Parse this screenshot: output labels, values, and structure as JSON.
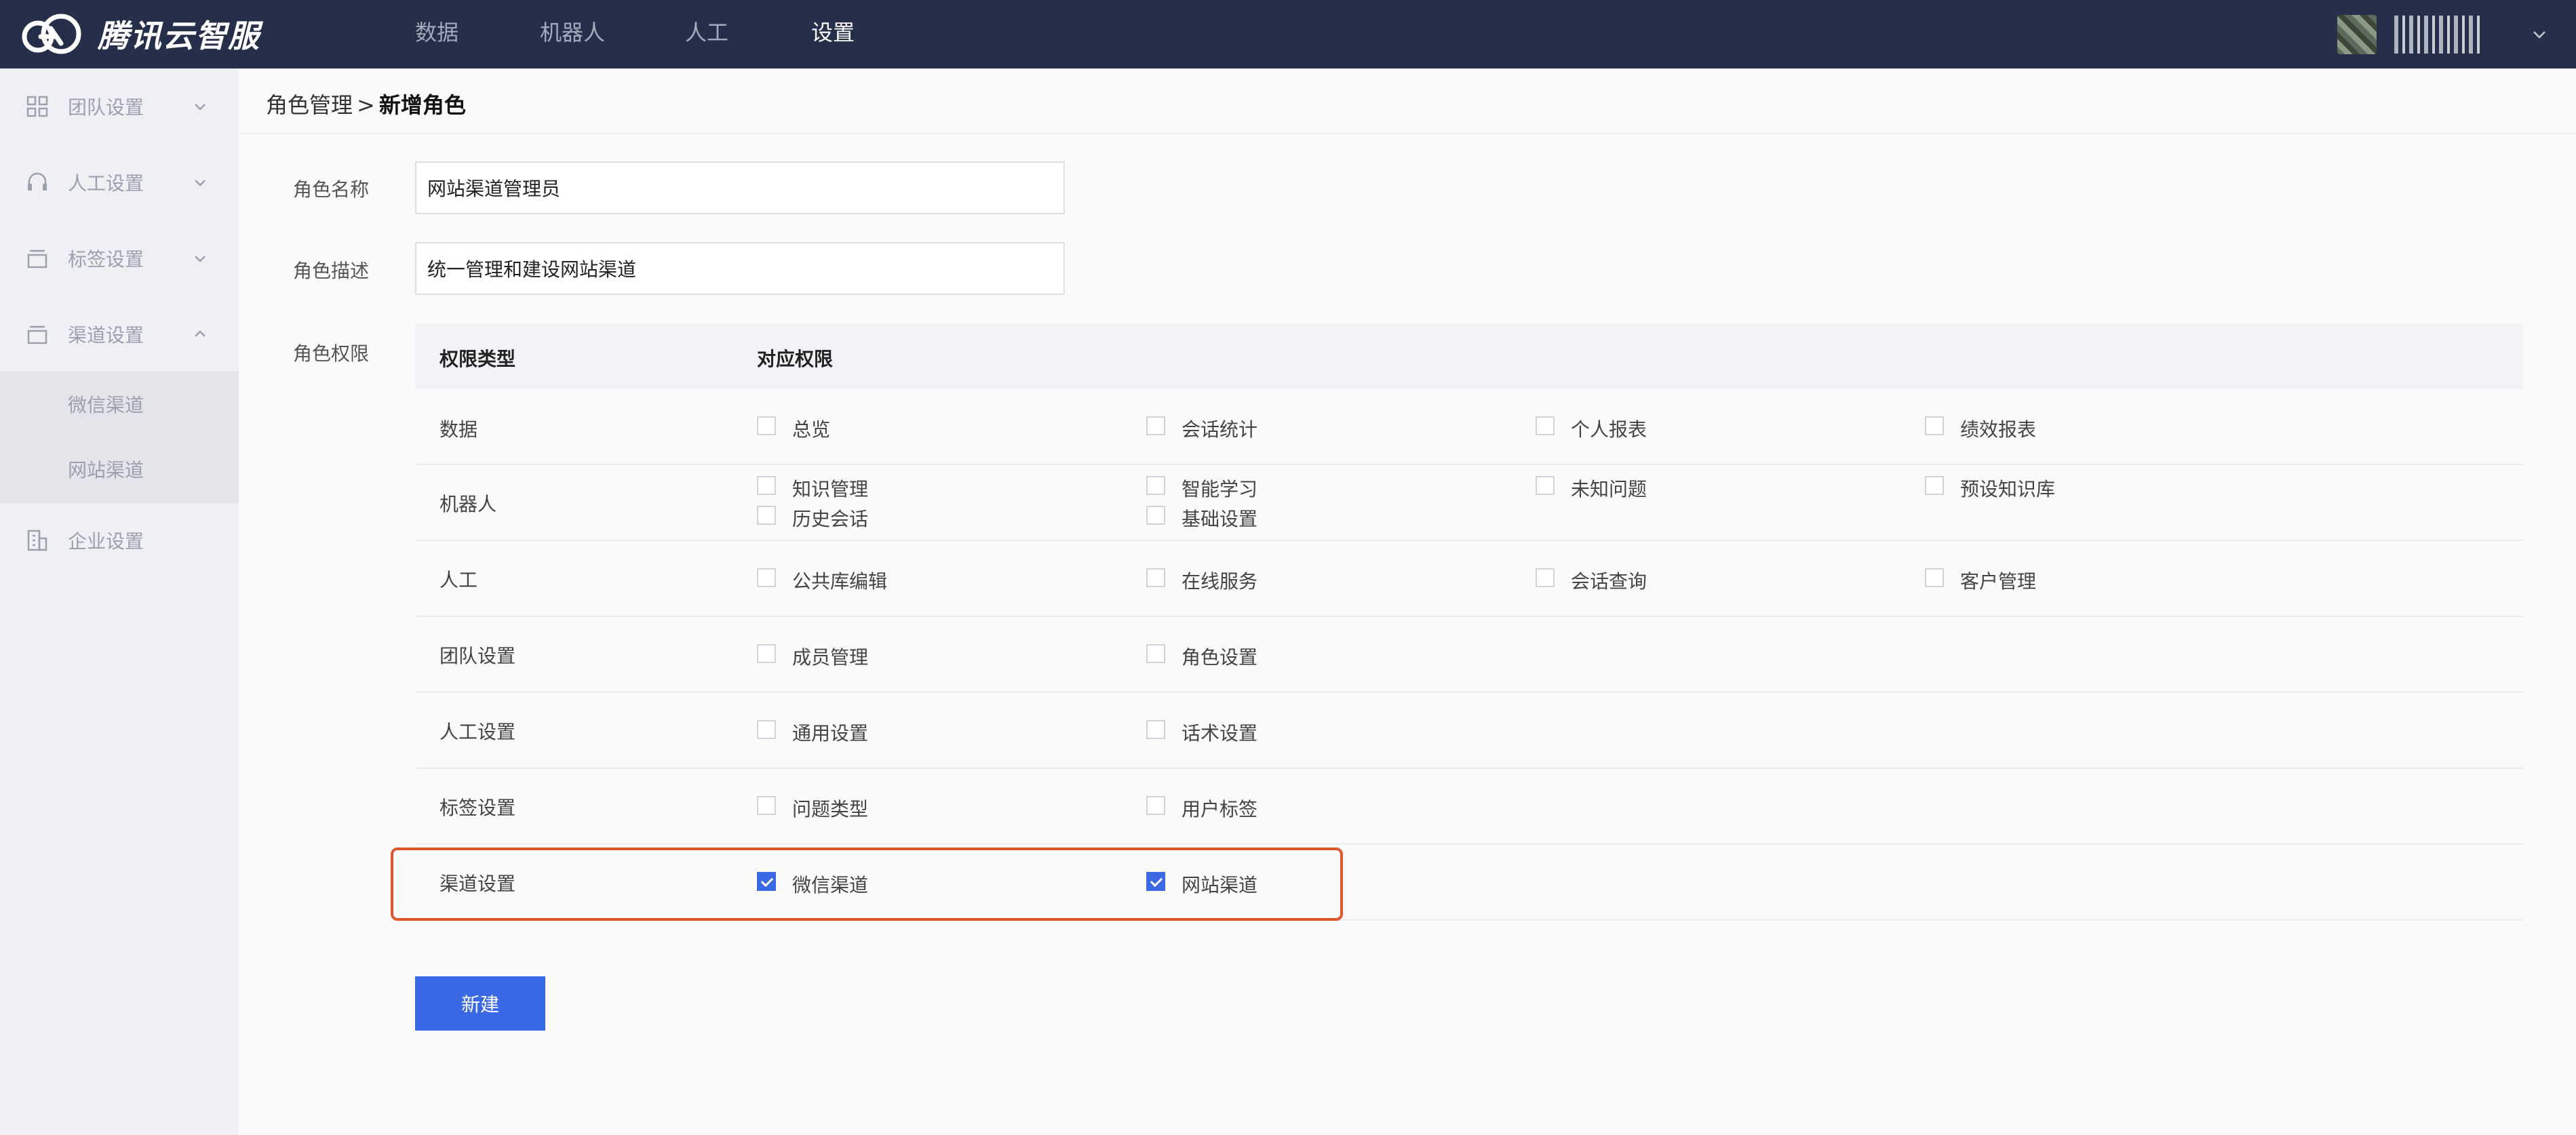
{
  "app": {
    "logo_text": "腾讯云智服"
  },
  "nav": {
    "items": [
      {
        "label": "数据",
        "active": false
      },
      {
        "label": "机器人",
        "active": false
      },
      {
        "label": "人工",
        "active": false
      },
      {
        "label": "设置",
        "active": true
      }
    ]
  },
  "sidebar": {
    "items": [
      {
        "label": "团队设置",
        "icon": "grid-icon",
        "expanded": false
      },
      {
        "label": "人工设置",
        "icon": "headset-icon",
        "expanded": false
      },
      {
        "label": "标签设置",
        "icon": "tag-box-icon",
        "expanded": false
      },
      {
        "label": "渠道设置",
        "icon": "channel-box-icon",
        "expanded": true
      },
      {
        "label": "企业设置",
        "icon": "building-icon",
        "expanded": false
      }
    ],
    "channel_sub_items": [
      "微信渠道",
      "网站渠道"
    ]
  },
  "breadcrumb": {
    "parent": "角色管理",
    "separator": ">",
    "current": "新增角色"
  },
  "form": {
    "role_name_label": "角色名称",
    "role_name_value": "网站渠道管理员",
    "role_desc_label": "角色描述",
    "role_desc_value": "统一管理和建设网站渠道",
    "role_perm_label": "角色权限"
  },
  "permissions": {
    "header_type": "权限类型",
    "header_perm": "对应权限",
    "rows": [
      {
        "label": "数据",
        "options": [
          {
            "label": "总览",
            "checked": false
          },
          {
            "label": "会话统计",
            "checked": false
          },
          {
            "label": "个人报表",
            "checked": false
          },
          {
            "label": "绩效报表",
            "checked": false
          }
        ]
      },
      {
        "label": "机器人",
        "options": [
          {
            "label": "知识管理",
            "checked": false
          },
          {
            "label": "智能学习",
            "checked": false
          },
          {
            "label": "未知问题",
            "checked": false
          },
          {
            "label": "预设知识库",
            "checked": false
          },
          {
            "label": "历史会话",
            "checked": false
          },
          {
            "label": "基础设置",
            "checked": false
          }
        ]
      },
      {
        "label": "人工",
        "options": [
          {
            "label": "公共库编辑",
            "checked": false
          },
          {
            "label": "在线服务",
            "checked": false
          },
          {
            "label": "会话查询",
            "checked": false
          },
          {
            "label": "客户管理",
            "checked": false
          }
        ]
      },
      {
        "label": "团队设置",
        "options": [
          {
            "label": "成员管理",
            "checked": false
          },
          {
            "label": "角色设置",
            "checked": false
          }
        ]
      },
      {
        "label": "人工设置",
        "options": [
          {
            "label": "通用设置",
            "checked": false
          },
          {
            "label": "话术设置",
            "checked": false
          }
        ]
      },
      {
        "label": "标签设置",
        "options": [
          {
            "label": "问题类型",
            "checked": false
          },
          {
            "label": "用户标签",
            "checked": false
          }
        ]
      },
      {
        "label": "渠道设置",
        "options": [
          {
            "label": "微信渠道",
            "checked": true
          },
          {
            "label": "网站渠道",
            "checked": true
          }
        ]
      }
    ]
  },
  "actions": {
    "create_label": "新建"
  },
  "colors": {
    "topbar": "#252f4a",
    "accent": "#3b68e4",
    "highlight": "#e0562f",
    "sidebar": "#eff0f4"
  }
}
